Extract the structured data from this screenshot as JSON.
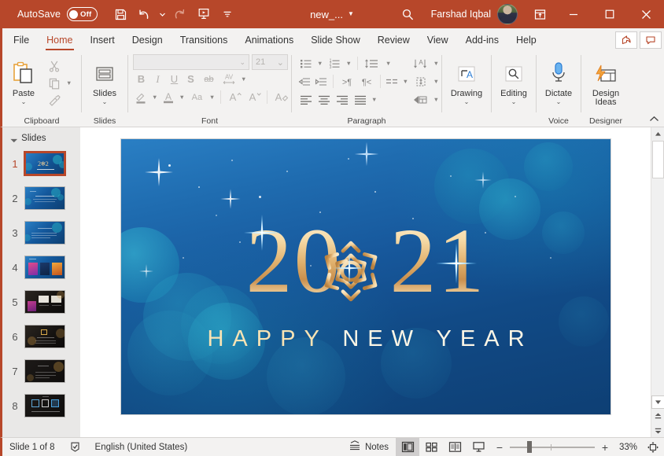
{
  "titlebar": {
    "autosave_label": "AutoSave",
    "autosave_state": "Off",
    "save_icon": "save-icon",
    "undo_icon": "undo-icon",
    "redo_icon": "redo-icon",
    "slideshow_icon": "start-slideshow-icon",
    "customize_icon": "customize-quick-access-icon",
    "document_title": "new_...",
    "search_icon": "search-icon",
    "user_name": "Farshad Iqbal",
    "ribbon_display_icon": "ribbon-display-options-icon",
    "minimize_icon": "minimize-icon",
    "maximize_icon": "maximize-icon",
    "close_icon": "close-icon",
    "accent_color": "#b7472a"
  },
  "tabs": [
    {
      "label": "File",
      "active": false
    },
    {
      "label": "Home",
      "active": true
    },
    {
      "label": "Insert",
      "active": false
    },
    {
      "label": "Design",
      "active": false
    },
    {
      "label": "Transitions",
      "active": false
    },
    {
      "label": "Animations",
      "active": false
    },
    {
      "label": "Slide Show",
      "active": false
    },
    {
      "label": "Review",
      "active": false
    },
    {
      "label": "View",
      "active": false
    },
    {
      "label": "Add-ins",
      "active": false
    },
    {
      "label": "Help",
      "active": false
    }
  ],
  "tab_right_buttons": [
    {
      "name": "share-button",
      "icon": "share-icon"
    },
    {
      "name": "comments-button",
      "icon": "comment-icon"
    }
  ],
  "ribbon": {
    "collapse_icon": "collapse-ribbon-chevron-up",
    "groups": [
      {
        "name": "clipboard",
        "label": "Clipboard",
        "dialog_launcher": true,
        "paste_label": "Paste",
        "paste_caret": "⌄",
        "cut_label": "Cut",
        "copy_label": "Copy",
        "format_painter_label": "Format Painter"
      },
      {
        "name": "slides",
        "label": "Slides",
        "slides_label": "Slides",
        "slides_caret": "⌄"
      },
      {
        "name": "font",
        "label": "Font",
        "dialog_launcher": true,
        "font_name_value": "",
        "font_size_value": "21",
        "bold": "B",
        "italic": "I",
        "underline": "U",
        "shadow": "S",
        "strikethrough": "ab",
        "character_spacing": "AV",
        "text_highlight": "text-highlight-icon",
        "font_color": "A",
        "change_case": "Aa",
        "increase_size": "A",
        "decrease_size": "A",
        "clear_formatting": "clear-formatting-icon"
      },
      {
        "name": "paragraph",
        "label": "Paragraph",
        "dialog_launcher": true,
        "bullets": "bullets-icon",
        "numbering": "numbering-icon",
        "line_spacing": "line-spacing-icon",
        "text_direction": "text-direction-icon",
        "decrease_indent": "decrease-indent-icon",
        "increase_indent": "increase-indent-icon",
        "ltr": "ltr-icon",
        "rtl": "rtl-icon",
        "columns": "columns-icon",
        "align_text": "align-text-icon",
        "align_left": "align-left-icon",
        "align_center": "align-center-icon",
        "align_right": "align-right-icon",
        "justify": "justify-icon",
        "smartart": "convert-to-smartart-icon"
      },
      {
        "name": "drawing",
        "label": "",
        "drawing_label": "Drawing",
        "drawing_caret": "⌄"
      },
      {
        "name": "editing",
        "label": "",
        "editing_label": "Editing",
        "editing_caret": "⌄"
      },
      {
        "name": "voice",
        "label": "Voice",
        "dictate_label": "Dictate",
        "dictate_caret": "⌄"
      },
      {
        "name": "designer",
        "label": "Designer",
        "design_ideas_label_1": "Design",
        "design_ideas_label_2": "Ideas"
      }
    ]
  },
  "thumbnails": {
    "header_label": "Slides",
    "items": [
      {
        "number": "1",
        "style": "blue-title",
        "selected": true
      },
      {
        "number": "2",
        "style": "blue-content",
        "selected": false
      },
      {
        "number": "3",
        "style": "blue-text",
        "selected": false
      },
      {
        "number": "4",
        "style": "blue-cards",
        "selected": false
      },
      {
        "number": "5",
        "style": "dark-cards",
        "selected": false
      },
      {
        "number": "6",
        "style": "dark-text",
        "selected": false
      },
      {
        "number": "7",
        "style": "dark-text2",
        "selected": false
      },
      {
        "number": "8",
        "style": "dark-icons",
        "selected": false
      }
    ]
  },
  "slide": {
    "year_text": "2021",
    "year_left": "20",
    "year_right": "21",
    "greeting": "HAPPY NEW YEAR",
    "greeting_first_word": "HAPPY",
    "greeting_rest": "NEW YEAR",
    "snowflake_icon": "snowflake-icon",
    "background_color": "#15589c",
    "gold_color": "#e8bd7a"
  },
  "scrollbar": {
    "up_icon": "scroll-up-icon",
    "down_icon": "scroll-down-icon",
    "previous_slide_icon": "previous-slide-icon",
    "next_slide_icon": "next-slide-icon"
  },
  "statusbar": {
    "slide_counter": "Slide 1 of 8",
    "accessibility_icon": "accessibility-check-icon",
    "language": "English (United States)",
    "notes_label": "Notes",
    "notes_icon": "notes-icon",
    "views": [
      {
        "name": "normal-view",
        "icon": "normal-view-icon",
        "active": true
      },
      {
        "name": "slide-sorter-view",
        "icon": "slide-sorter-icon",
        "active": false
      },
      {
        "name": "reading-view",
        "icon": "reading-view-icon",
        "active": false
      },
      {
        "name": "slide-show-view",
        "icon": "slide-show-icon",
        "active": false
      }
    ],
    "zoom_out": "−",
    "zoom_in": "+",
    "zoom_level": "33%",
    "fit_icon": "fit-slide-to-window-icon"
  }
}
